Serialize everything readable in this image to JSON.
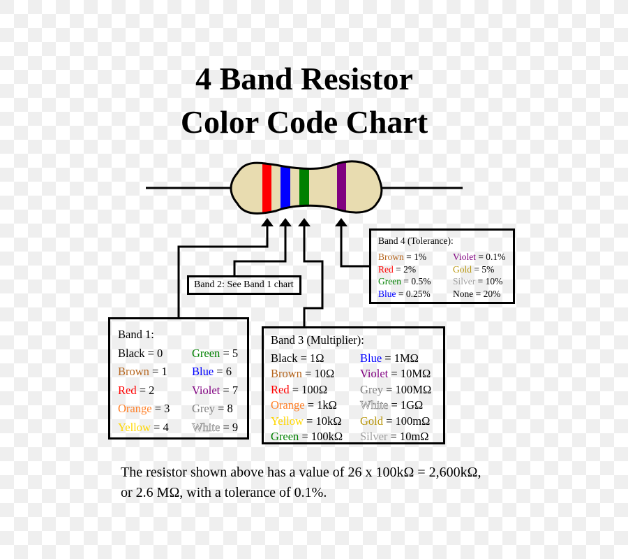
{
  "title": {
    "line1": "4 Band Resistor",
    "line2": "Color Code Chart"
  },
  "resistor": {
    "body_color": "#e8dcb0",
    "bands": [
      {
        "name": "band-1",
        "color_name": "Red",
        "color": "#ff0000"
      },
      {
        "name": "band-2",
        "color_name": "Blue",
        "color": "#0000ff"
      },
      {
        "name": "band-3",
        "color_name": "Green",
        "color": "#008000"
      },
      {
        "name": "band-4",
        "color_name": "Violet",
        "color": "#800080"
      }
    ]
  },
  "colors": {
    "Black": "#000000",
    "Brown": "#b5651d",
    "Red": "#ff0000",
    "Orange": "#ff7f27",
    "Yellow": "#ffd700",
    "Green": "#008000",
    "Blue": "#0000ff",
    "Violet": "#800080",
    "Grey": "#808080",
    "White": "#ffffff",
    "Gold": "#b8960b",
    "Silver": "#a0a0a0",
    "None": "#000000"
  },
  "band1": {
    "heading": "Band 1:",
    "rows": [
      {
        "color": "Black",
        "value": " = 0"
      },
      {
        "color": "Green",
        "value": " = 5"
      },
      {
        "color": "Brown",
        "value": " = 1"
      },
      {
        "color": "Blue",
        "value": " = 6"
      },
      {
        "color": "Red",
        "value": " = 2"
      },
      {
        "color": "Violet",
        "value": " = 7"
      },
      {
        "color": "Orange",
        "value": " = 3"
      },
      {
        "color": "Grey",
        "value": " = 8"
      },
      {
        "color": "Yellow",
        "value": " = 4"
      },
      {
        "color": "White",
        "value": " = 9"
      }
    ]
  },
  "band2": {
    "label": "Band 2: See Band 1 chart"
  },
  "band3": {
    "heading": "Band 3 (Multiplier):",
    "rows": [
      {
        "color": "Black",
        "value": " = 1Ω"
      },
      {
        "color": "Blue",
        "value": " = 1MΩ"
      },
      {
        "color": "Brown",
        "value": " = 10Ω"
      },
      {
        "color": "Violet",
        "value": " = 10MΩ"
      },
      {
        "color": "Red",
        "value": " = 100Ω"
      },
      {
        "color": "Grey",
        "value": " = 100MΩ"
      },
      {
        "color": "Orange",
        "value": " = 1kΩ"
      },
      {
        "color": "White",
        "value": " = 1GΩ"
      },
      {
        "color": "Yellow",
        "value": " = 10kΩ"
      },
      {
        "color": "Gold",
        "value": " = 100mΩ"
      },
      {
        "color": "Green",
        "value": " = 100kΩ"
      },
      {
        "color": "Silver",
        "value": " = 10mΩ"
      }
    ]
  },
  "band4": {
    "heading": "Band 4 (Tolerance):",
    "rows": [
      {
        "color": "Brown",
        "value": " = 1%"
      },
      {
        "color": "Violet",
        "value": " = 0.1%"
      },
      {
        "color": "Red",
        "value": " = 2%"
      },
      {
        "color": "Gold",
        "value": " = 5%"
      },
      {
        "color": "Green",
        "value": " = 0.5%"
      },
      {
        "color": "Silver",
        "value": " = 10%"
      },
      {
        "color": "Blue",
        "value": " = 0.25%"
      },
      {
        "color": "None",
        "value": " = 20%"
      }
    ]
  },
  "note": {
    "line1": "The resistor shown above has a value of 26 x 100kΩ = 2,600kΩ,",
    "line2": "or 2.6 MΩ, with a tolerance of 0.1%."
  }
}
